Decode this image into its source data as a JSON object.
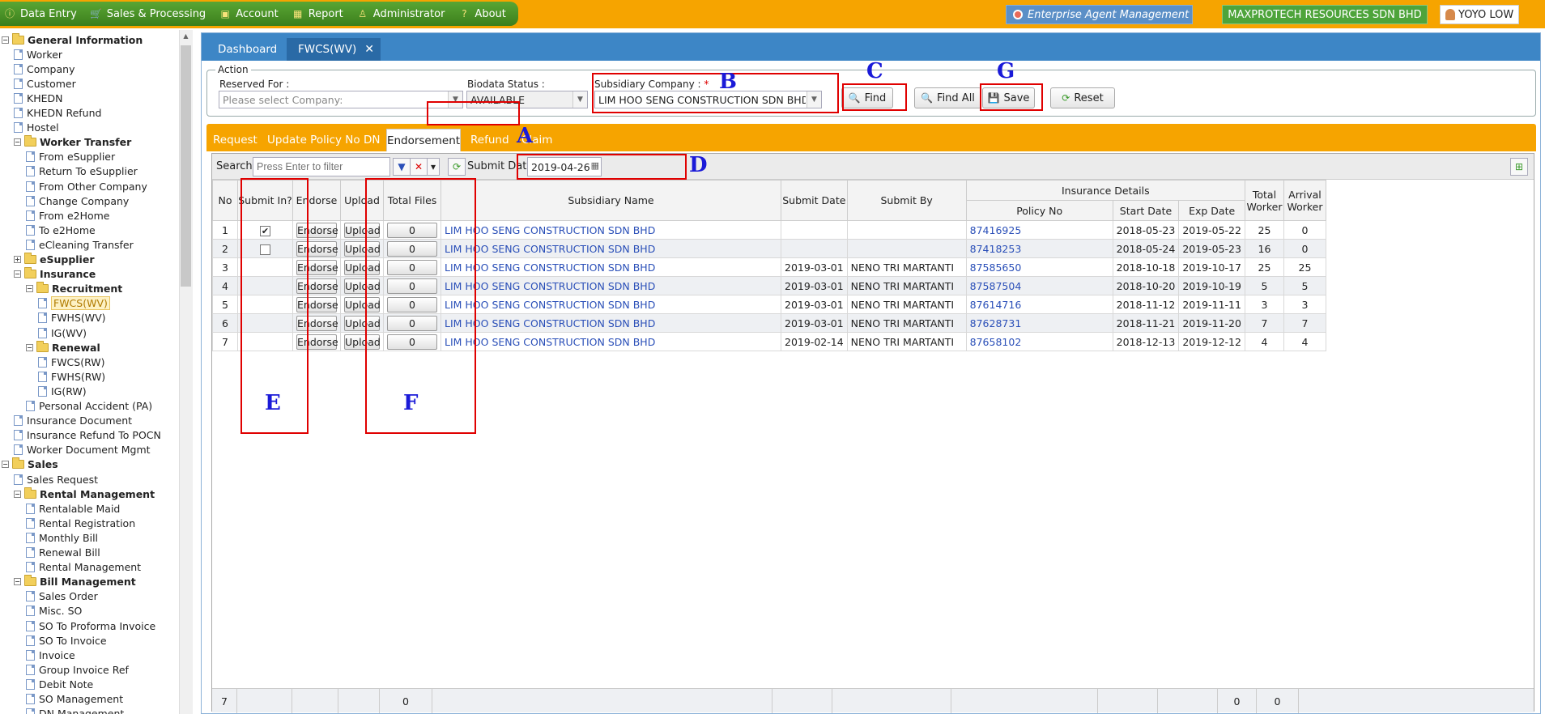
{
  "menubar": {
    "items": [
      {
        "label": "Data Entry",
        "icon": "info-icon"
      },
      {
        "label": "Sales & Processing",
        "icon": "cart-icon"
      },
      {
        "label": "Account",
        "icon": "briefcase-icon"
      },
      {
        "label": "Report",
        "icon": "grid-icon"
      },
      {
        "label": "Administrator",
        "icon": "admin-icon"
      },
      {
        "label": "About",
        "icon": "question-icon"
      }
    ],
    "enterprise": "Enterprise Agent Management",
    "company": "MAXPROTECH RESOURCES SDN BHD",
    "user": "YOYO LOW"
  },
  "sidebar": {
    "items": [
      {
        "label": "General Information",
        "level": 0,
        "type": "folder",
        "bold": true
      },
      {
        "label": "Worker",
        "level": 1,
        "type": "doc"
      },
      {
        "label": "Company",
        "level": 1,
        "type": "doc"
      },
      {
        "label": "Customer",
        "level": 1,
        "type": "doc"
      },
      {
        "label": "KHEDN",
        "level": 1,
        "type": "doc"
      },
      {
        "label": "KHEDN Refund",
        "level": 1,
        "type": "doc"
      },
      {
        "label": "Hostel",
        "level": 1,
        "type": "doc"
      },
      {
        "label": "Worker Transfer",
        "level": 1,
        "type": "folder",
        "bold": true
      },
      {
        "label": "From eSupplier",
        "level": 2,
        "type": "doc"
      },
      {
        "label": "Return To eSupplier",
        "level": 2,
        "type": "doc"
      },
      {
        "label": "From Other Company",
        "level": 2,
        "type": "doc"
      },
      {
        "label": "Change Company",
        "level": 2,
        "type": "doc"
      },
      {
        "label": "From e2Home",
        "level": 2,
        "type": "doc"
      },
      {
        "label": "To e2Home",
        "level": 2,
        "type": "doc"
      },
      {
        "label": "eCleaning Transfer",
        "level": 2,
        "type": "doc"
      },
      {
        "label": "eSupplier",
        "level": 1,
        "type": "folder",
        "bold": true,
        "collapsed": true
      },
      {
        "label": "Insurance",
        "level": 1,
        "type": "folder",
        "bold": true
      },
      {
        "label": "Recruitment",
        "level": 2,
        "type": "folder",
        "bold": true
      },
      {
        "label": "FWCS(WV)",
        "level": 3,
        "type": "doc",
        "selected": true
      },
      {
        "label": "FWHS(WV)",
        "level": 3,
        "type": "doc"
      },
      {
        "label": "IG(WV)",
        "level": 3,
        "type": "doc"
      },
      {
        "label": "Renewal",
        "level": 2,
        "type": "folder",
        "bold": true
      },
      {
        "label": "FWCS(RW)",
        "level": 3,
        "type": "doc"
      },
      {
        "label": "FWHS(RW)",
        "level": 3,
        "type": "doc"
      },
      {
        "label": "IG(RW)",
        "level": 3,
        "type": "doc"
      },
      {
        "label": "Personal Accident (PA)",
        "level": 2,
        "type": "doc"
      },
      {
        "label": "Insurance Document",
        "level": 1,
        "type": "doc"
      },
      {
        "label": "Insurance Refund To POCN",
        "level": 1,
        "type": "doc"
      },
      {
        "label": "Worker Document Mgmt",
        "level": 1,
        "type": "doc"
      },
      {
        "label": "Sales",
        "level": 0,
        "type": "folder",
        "bold": true
      },
      {
        "label": "Sales Request",
        "level": 1,
        "type": "doc"
      },
      {
        "label": "Rental Management",
        "level": 1,
        "type": "folder",
        "bold": true
      },
      {
        "label": "Rentalable Maid",
        "level": 2,
        "type": "doc"
      },
      {
        "label": "Rental Registration",
        "level": 2,
        "type": "doc"
      },
      {
        "label": "Monthly Bill",
        "level": 2,
        "type": "doc"
      },
      {
        "label": "Renewal Bill",
        "level": 2,
        "type": "doc"
      },
      {
        "label": "Rental Management",
        "level": 2,
        "type": "doc"
      },
      {
        "label": "Bill Management",
        "level": 1,
        "type": "folder",
        "bold": true
      },
      {
        "label": "Sales Order",
        "level": 2,
        "type": "doc"
      },
      {
        "label": "Misc. SO",
        "level": 2,
        "type": "doc"
      },
      {
        "label": "SO To Proforma Invoice",
        "level": 2,
        "type": "doc"
      },
      {
        "label": "SO To Invoice",
        "level": 2,
        "type": "doc"
      },
      {
        "label": "Invoice",
        "level": 2,
        "type": "doc"
      },
      {
        "label": "Group Invoice Ref",
        "level": 2,
        "type": "doc"
      },
      {
        "label": "Debit Note",
        "level": 2,
        "type": "doc"
      },
      {
        "label": "SO Management",
        "level": 2,
        "type": "doc"
      },
      {
        "label": "DN Management",
        "level": 2,
        "type": "doc"
      }
    ]
  },
  "tabs": {
    "dashboard": "Dashboard",
    "active": "FWCS(WV)",
    "close": "✕"
  },
  "action": {
    "legend": "Action",
    "reserved_label": "Reserved For :",
    "reserved_placeholder": "Please select Company:",
    "biodata_label": "Biodata Status :",
    "biodata_value": "AVAILABLE",
    "subsidiary_label": "Subsidiary Company :",
    "subsidiary_required": "*",
    "subsidiary_value": "LIM HOO SENG CONSTRUCTION  SDN BHD",
    "find": "Find",
    "find_all": "Find All",
    "save": "Save",
    "reset": "Reset"
  },
  "subtabs": [
    "Request",
    "Update Policy No",
    "DN",
    "Endorsement",
    "Refund",
    "Claim"
  ],
  "toolbar": {
    "search_label": "Search:",
    "search_placeholder": "Press Enter to filter",
    "submit_date_label": "Submit Date:",
    "submit_date_value": "2019-04-26"
  },
  "table": {
    "headers": {
      "no": "No",
      "submit_in": "Submit In?",
      "endorse": "Endorse",
      "upload": "Upload",
      "total_files": "Total Files",
      "subsidiary_name": "Subsidiary Name",
      "submit_date": "Submit Date",
      "submit_by": "Submit By",
      "insurance_details": "Insurance Details",
      "policy_no": "Policy No",
      "start_date": "Start Date",
      "exp_date": "Exp Date",
      "total_worker": "Total Worker",
      "arrival_worker": "Arrival Worker"
    },
    "endorse_label": "Endorse",
    "upload_label": "Upload",
    "rows": [
      {
        "no": "1",
        "checkbox": "checked",
        "files": "0",
        "name": "LIM HOO SENG CONSTRUCTION SDN BHD",
        "submit_date": "",
        "submit_by": "",
        "policy": "87416925",
        "start": "2018-05-23",
        "exp": "2019-05-22",
        "total": "25",
        "arrival": "0"
      },
      {
        "no": "2",
        "checkbox": "unchecked",
        "files": "0",
        "name": "LIM HOO SENG CONSTRUCTION SDN BHD",
        "submit_date": "",
        "submit_by": "",
        "policy": "87418253",
        "start": "2018-05-24",
        "exp": "2019-05-23",
        "total": "16",
        "arrival": "0"
      },
      {
        "no": "3",
        "checkbox": "none",
        "files": "0",
        "name": "LIM HOO SENG CONSTRUCTION SDN BHD",
        "submit_date": "2019-03-01",
        "submit_by": "NENO TRI MARTANTI",
        "policy": "87585650",
        "start": "2018-10-18",
        "exp": "2019-10-17",
        "total": "25",
        "arrival": "25"
      },
      {
        "no": "4",
        "checkbox": "none",
        "files": "0",
        "name": "LIM HOO SENG CONSTRUCTION SDN BHD",
        "submit_date": "2019-03-01",
        "submit_by": "NENO TRI MARTANTI",
        "policy": "87587504",
        "start": "2018-10-20",
        "exp": "2019-10-19",
        "total": "5",
        "arrival": "5"
      },
      {
        "no": "5",
        "checkbox": "none",
        "files": "0",
        "name": "LIM HOO SENG CONSTRUCTION SDN BHD",
        "submit_date": "2019-03-01",
        "submit_by": "NENO TRI MARTANTI",
        "policy": "87614716",
        "start": "2018-11-12",
        "exp": "2019-11-11",
        "total": "3",
        "arrival": "3"
      },
      {
        "no": "6",
        "checkbox": "none",
        "files": "0",
        "name": "LIM HOO SENG CONSTRUCTION SDN BHD",
        "submit_date": "2019-03-01",
        "submit_by": "NENO TRI MARTANTI",
        "policy": "87628731",
        "start": "2018-11-21",
        "exp": "2019-11-20",
        "total": "7",
        "arrival": "7"
      },
      {
        "no": "7",
        "checkbox": "none",
        "files": "0",
        "name": "LIM HOO SENG CONSTRUCTION SDN BHD",
        "submit_date": "2019-02-14",
        "submit_by": "NENO TRI MARTANTI",
        "policy": "87658102",
        "start": "2018-12-13",
        "exp": "2019-12-12",
        "total": "4",
        "arrival": "4"
      }
    ],
    "footer": {
      "count": "7",
      "files_sum": "0",
      "total_sum": "0",
      "arrival_sum": "0"
    }
  },
  "annotations": [
    "A",
    "B",
    "C",
    "D",
    "E",
    "F",
    "G"
  ],
  "colors": {
    "menubar_green": "#4a9428",
    "topbar_orange": "#f6a400",
    "tab_blue": "#3d86c6",
    "highlight_red": "#e00000",
    "annotation_blue": "#1a1ad8",
    "link_blue": "#2a4fb8"
  }
}
